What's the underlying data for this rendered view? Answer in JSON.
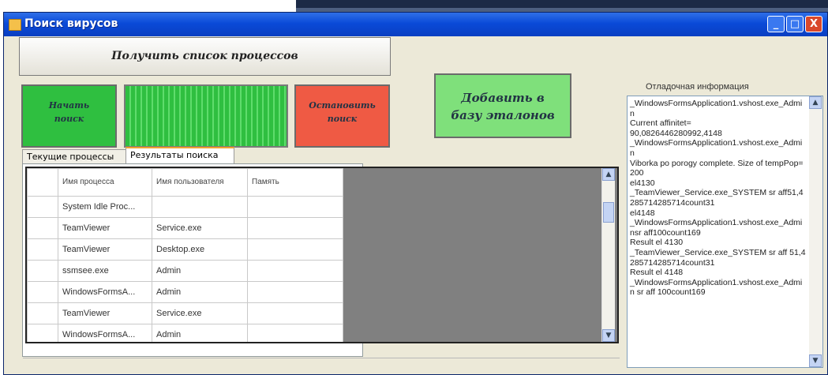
{
  "window": {
    "title": "Поиск вирусов",
    "min": "_",
    "max": "□",
    "close": "X"
  },
  "buttons": {
    "get_processes": "Получить список процессов",
    "start": "Начать\nпоиск",
    "stop": "Остановить\nпоиск",
    "add_reference": "Добавить в\nбазу эталонов"
  },
  "progress": {
    "value": 1.0
  },
  "tabs": [
    {
      "label": "Текущие процессы"
    },
    {
      "label": "Результаты поиска",
      "selected": true
    }
  ],
  "grid": {
    "headers": [
      "Имя процесса",
      "Имя пользователя",
      "Память"
    ],
    "rows": [
      [
        "System Idle Proc...",
        "",
        ""
      ],
      [
        "TeamViewer",
        "Service.exe",
        ""
      ],
      [
        "TeamViewer",
        "Desktop.exe",
        ""
      ],
      [
        "ssmsee.exe",
        "Admin",
        ""
      ],
      [
        "WindowsFormsA...",
        "Admin",
        ""
      ],
      [
        "TeamViewer",
        "Service.exe",
        ""
      ],
      [
        "WindowsFormsA...",
        "Admin",
        ""
      ]
    ]
  },
  "debug": {
    "label": "Отладочная информация",
    "text": "_WindowsFormsApplication1.vshost.exe_Admin\nCurrent affinitet=\n90,0826446280992,4148\n_WindowsFormsApplication1.vshost.exe_Admin\nViborka po porogy complete. Size of tempPop=200\nel4130\n_TeamViewer_Service.exe_SYSTEM sr aff51,4285714285714count31\nel4148\n_WindowsFormsApplication1.vshost.exe_Adminsr aff100count169\nResult el 4130\n_TeamViewer_Service.exe_SYSTEM sr aff 51,4285714285714count31\nResult el 4148\n_WindowsFormsApplication1.vshost.exe_Admin sr aff 100count169"
  },
  "colors": {
    "start": "#2fbf40",
    "stop": "#ef5a44",
    "add": "#7fe07b",
    "titlebar": "#0a4ad8"
  }
}
